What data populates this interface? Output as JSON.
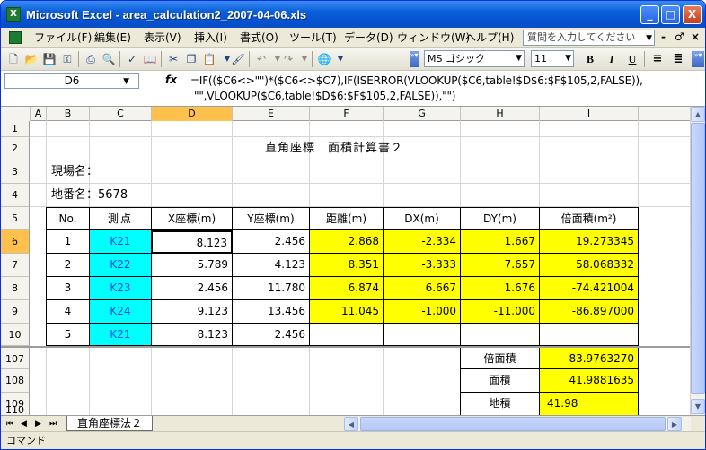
{
  "window": {
    "title": "Microsoft Excel - area_calculation2_2007-04-06.xls",
    "app_icon": "excel-icon",
    "controls": [
      "_",
      "□",
      "X"
    ]
  },
  "menu": {
    "items": [
      "ファイル(F)",
      "編集(E)",
      "表示(V)",
      "挿入(I)",
      "書式(O)",
      "ツール(T)",
      "データ(D)",
      "ウィンドウ(W)",
      "ヘルプ(H)"
    ],
    "help_placeholder": "質問を入力してください",
    "doc_controls": [
      "-",
      "♂",
      "×"
    ]
  },
  "toolbar": {
    "font_name": "MS ゴシック",
    "font_size": "11",
    "bold": "B",
    "italic": "I",
    "underline": "U"
  },
  "formula_bar": {
    "name_box": "D6",
    "fx": "fx",
    "formula_line1": "=IF(($C6<>\"\")*($C6<>$C7),IF(ISERROR(VLOOKUP($C6,table!$D$6:$F$105,2,FALSE)),",
    "formula_line2": "\"\",VLOOKUP($C6,table!$D$6:$F$105,2,FALSE)),\"\")"
  },
  "columns": [
    "A",
    "B",
    "C",
    "D",
    "E",
    "F",
    "G",
    "H",
    "I"
  ],
  "selected_column": "D",
  "rows": [
    "1",
    "2",
    "3",
    "4",
    "5",
    "6",
    "7",
    "8",
    "9",
    "10",
    "107",
    "108",
    "109",
    "110"
  ],
  "selected_row": "6",
  "sheet": {
    "title": "直角座標　面積計算書２",
    "site_name_label": "現場名：",
    "lot_number_label": "地番名：5678",
    "headers": [
      "No.",
      "測点",
      "X座標(m)",
      "Y座標(m)",
      "距離(m)",
      "DX(m)",
      "DY(m)",
      "倍面積(m²)"
    ],
    "data_rows": [
      [
        "1",
        "K21",
        "8.123",
        "2.456",
        "2.868",
        "-2.334",
        "1.667",
        "19.273345"
      ],
      [
        "2",
        "K22",
        "5.789",
        "4.123",
        "8.351",
        "-3.333",
        "7.657",
        "58.068332"
      ],
      [
        "3",
        "K23",
        "2.456",
        "11.780",
        "6.874",
        "6.667",
        "1.676",
        "-74.421004"
      ],
      [
        "4",
        "K24",
        "9.123",
        "13.456",
        "11.045",
        "-1.000",
        "-11.000",
        "-86.897000"
      ],
      [
        "5",
        "K21",
        "8.123",
        "2.456",
        "",
        "",
        "",
        ""
      ]
    ],
    "summary": [
      {
        "label": "倍面積",
        "value": "-83.9763270"
      },
      {
        "label": "面積",
        "value": "41.9881635"
      },
      {
        "label": "地積",
        "value": "41.98"
      }
    ]
  },
  "sheet_tab": "直角座標法２",
  "status": "コマンド",
  "colors": {
    "cyan_fill": "#00FFFF",
    "yellow_fill": "#FFFF00",
    "selection_header": "#FFC04C"
  }
}
